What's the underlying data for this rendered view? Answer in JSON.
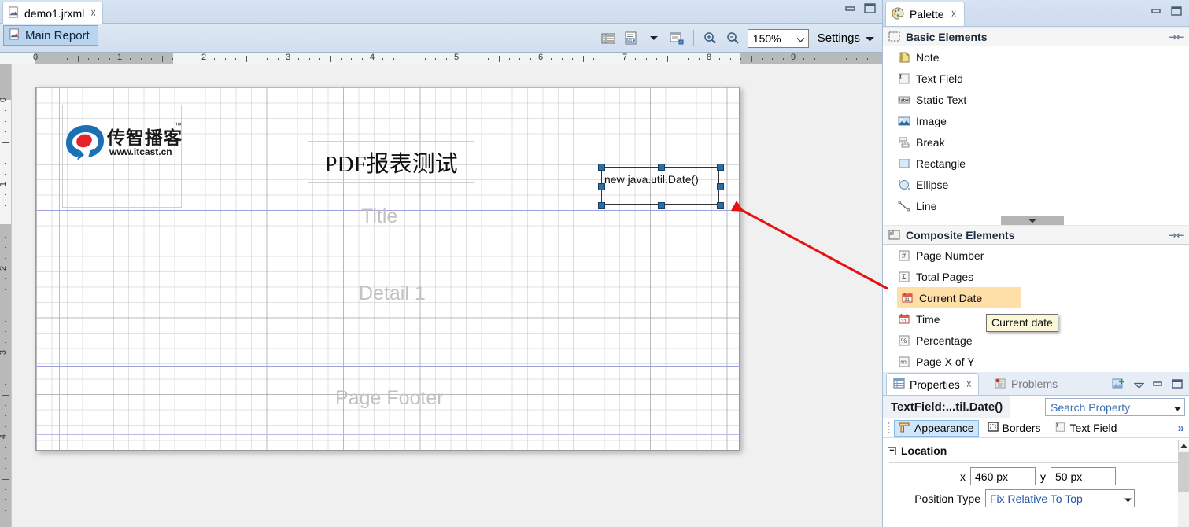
{
  "editor": {
    "tab": {
      "label": "demo1.jrxml",
      "close": "☓",
      "icon": "jrxml-file-icon"
    },
    "window_buttons": {
      "minimize": "minimize-icon",
      "maximize": "maximize-icon"
    },
    "toolbar": {
      "main_report_tab": "Main Report",
      "zoom_value": "150%",
      "settings_label": "Settings",
      "icons": [
        "fields-list-icon",
        "dataset-icon",
        "dataset-dropdown-caret",
        "preview-icon",
        "zoom-in-icon",
        "zoom-out-icon"
      ]
    },
    "ruler_h": {
      "labels": [
        "0",
        "1",
        "2",
        "3",
        "4",
        "5",
        "6",
        "7",
        "8",
        "9"
      ],
      "unit": "in"
    },
    "ruler_v": {
      "labels": [
        "0",
        "1",
        "2",
        "3",
        "4"
      ],
      "unit": "in"
    },
    "canvas": {
      "bands": [
        {
          "name": "Title",
          "label": "Title"
        },
        {
          "name": "Detail 1",
          "label": "Detail 1"
        },
        {
          "name": "Page Footer",
          "label": "Page Footer"
        }
      ],
      "elements": {
        "logo": {
          "name": "itcast-logo",
          "text_cn": "传智播客",
          "tm": "™",
          "url": "www.itcast.cn"
        },
        "title_text": {
          "name": "title-static-text",
          "text": "PDF报表测试"
        },
        "date_field": {
          "name": "date-text-field",
          "text": "new java.util.Date()",
          "selected": true,
          "handles": 8
        }
      }
    }
  },
  "palette": {
    "tab_label": "Palette",
    "tab_close": "☓",
    "groups": [
      {
        "title": "Basic Elements",
        "icon": "basic-elements-icon",
        "items": [
          {
            "label": "Note",
            "icon": "note-icon"
          },
          {
            "label": "Text Field",
            "icon": "text-field-icon"
          },
          {
            "label": "Static Text",
            "icon": "static-text-icon"
          },
          {
            "label": "Image",
            "icon": "image-icon"
          },
          {
            "label": "Break",
            "icon": "break-icon"
          },
          {
            "label": "Rectangle",
            "icon": "rectangle-icon"
          },
          {
            "label": "Ellipse",
            "icon": "ellipse-icon"
          },
          {
            "label": "Line",
            "icon": "line-icon"
          }
        ]
      },
      {
        "title": "Composite Elements",
        "icon": "composite-elements-icon",
        "items": [
          {
            "label": "Page Number",
            "icon": "page-number-icon"
          },
          {
            "label": "Total Pages",
            "icon": "total-pages-icon"
          },
          {
            "label": "Current Date",
            "icon": "current-date-icon",
            "highlighted": true
          },
          {
            "label": "Time",
            "icon": "time-icon"
          },
          {
            "label": "Percentage",
            "icon": "percentage-icon"
          },
          {
            "label": "Page X of Y",
            "icon": "page-x-of-y-icon"
          }
        ]
      }
    ],
    "tooltip": "Current date"
  },
  "properties": {
    "tabs": [
      {
        "label": "Properties",
        "active": true,
        "icon": "properties-icon",
        "close": "☓"
      },
      {
        "label": "Problems",
        "active": false,
        "icon": "problems-icon"
      }
    ],
    "toolbar_icons": [
      "new-view-icon",
      "view-menu-caret",
      "minimize-icon",
      "maximize-icon"
    ],
    "selected_element": "TextField:...til.Date()",
    "search_placeholder": "Search Property",
    "section_tabs": [
      {
        "label": "Appearance",
        "active": true,
        "icon": "appearance-icon"
      },
      {
        "label": "Borders",
        "active": false,
        "icon": "borders-icon"
      },
      {
        "label": "Text Field",
        "active": false,
        "icon": "text-field-icon"
      }
    ],
    "more_tabs": "»",
    "sections": [
      {
        "title": "Location",
        "expander": "−",
        "fields": [
          {
            "label": "x",
            "value": "460 px"
          },
          {
            "label": "y",
            "value": "50 px"
          }
        ],
        "row2": {
          "label": "Position Type",
          "value": "Fix Relative To Top"
        }
      }
    ]
  },
  "annotation": {
    "arrow": "red-arrow",
    "color": "#e8110f"
  }
}
